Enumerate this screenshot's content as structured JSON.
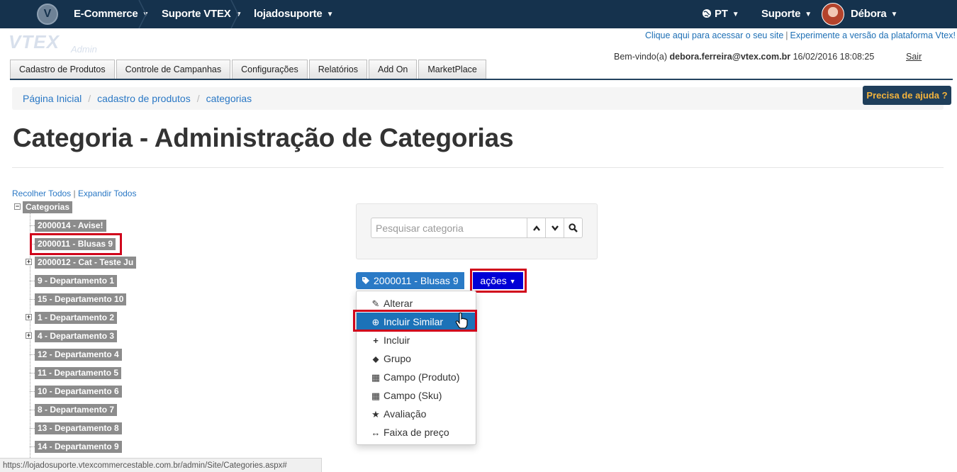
{
  "topbar": {
    "logo_letter": "V",
    "crumbs": [
      "E-Commerce",
      "Suporte VTEX",
      "lojadosuporte"
    ],
    "language": "PT",
    "support": "Suporte",
    "user": "Débora"
  },
  "header": {
    "logo": "VTEX",
    "logo_sub": "Admin",
    "link_site": "Clique aqui para acessar o seu site",
    "link_experiment": "Experimente a versão da plataforma Vtex!",
    "welcome_prefix": "Bem-vindo(a)",
    "user_email": "debora.ferreira@vtex.com.br",
    "datetime": "16/02/2016 18:08:25",
    "logout": "Sair"
  },
  "main_tabs": [
    "Cadastro de Produtos",
    "Controle de Campanhas",
    "Configurações",
    "Relatórios",
    "Add On",
    "MarketPlace"
  ],
  "breadcrumb": [
    "Página Inicial",
    "cadastro de produtos",
    "categorias"
  ],
  "help_button": "Precisa de ajuda ?",
  "page_title": "Categoria - Administração de Categorias",
  "tree": {
    "collapse_all": "Recolher Todos",
    "expand_all": "Expandir Todos",
    "root": "Categorias",
    "items": [
      "2000014 - Avise!",
      "2000011 - Blusas 9",
      "2000012 - Cat - Teste Ju",
      "9 - Departamento 1",
      "15 - Departamento 10",
      "1 - Departamento 2",
      "4 - Departamento 3",
      "12 - Departamento 4",
      "11 - Departamento 5",
      "10 - Departamento 6",
      "8 - Departamento 7",
      "13 - Departamento 8",
      "14 - Departamento 9"
    ]
  },
  "search": {
    "placeholder": "Pesquisar categoria"
  },
  "selected_category": "2000011 - Blusas 9",
  "actions": {
    "label": "ações",
    "items": [
      "Alterar",
      "Incluir Similar",
      "Incluir",
      "Grupo",
      "Campo (Produto)",
      "Campo (Sku)",
      "Avaliação",
      "Faixa de preço"
    ]
  },
  "status_url": "https://lojadosuporte.vtexcommercestable.com.br/admin/Site/Categories.aspx#",
  "colors": {
    "topbar": "#15324d",
    "link": "#2a78c5",
    "highlight": "#d0021b",
    "active_menu": "#1c72b8",
    "acoes": "#0000d6",
    "help_text": "#f3b33c"
  }
}
